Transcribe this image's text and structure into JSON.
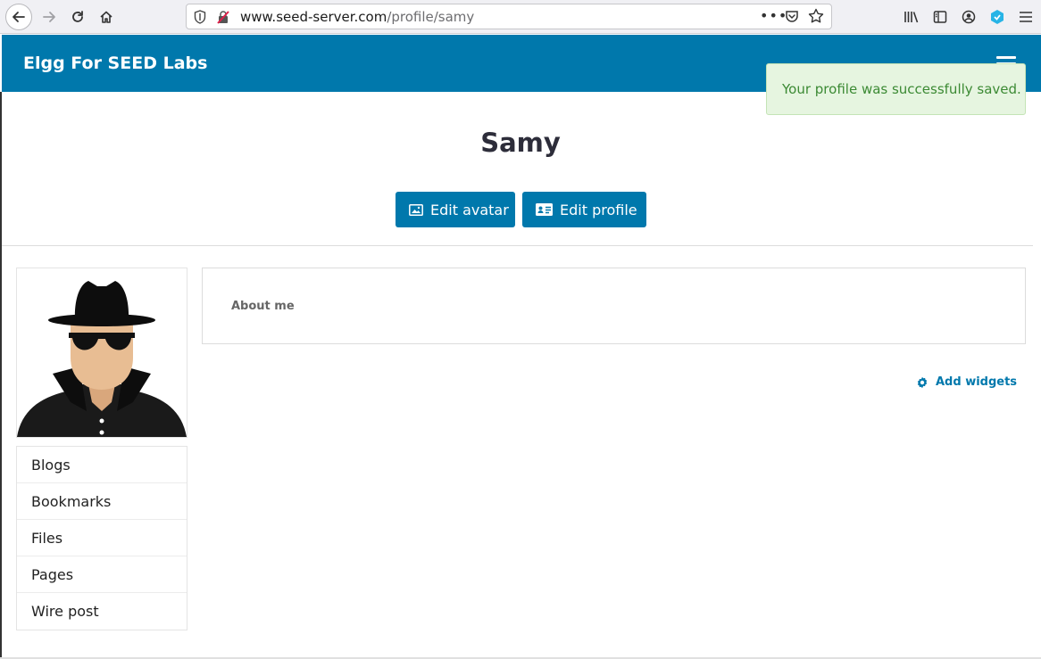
{
  "browser": {
    "url_host": "www.seed-server.com",
    "url_path": "/profile/samy",
    "more_label": "•••"
  },
  "header": {
    "site_title": "Elgg For SEED Labs"
  },
  "notification": {
    "message": "Your profile was successfully saved."
  },
  "profile": {
    "name": "Samy",
    "edit_avatar_label": "Edit avatar",
    "edit_profile_label": "Edit profile"
  },
  "sidebar": {
    "items": [
      {
        "label": "Blogs"
      },
      {
        "label": "Bookmarks"
      },
      {
        "label": "Files"
      },
      {
        "label": "Pages"
      },
      {
        "label": "Wire post"
      }
    ]
  },
  "main": {
    "about_title": "About me",
    "add_widgets_label": "Add widgets"
  },
  "colors": {
    "brand": "#0078ac",
    "success_bg": "#e6f5e0",
    "success_text": "#3c8a34"
  },
  "icons": [
    "back-icon",
    "forward-icon",
    "reload-icon",
    "home-icon",
    "shield-icon",
    "insecure-lock-icon",
    "pocket-icon",
    "star-icon",
    "library-icon",
    "sidebar-icon",
    "account-icon",
    "extension-icon",
    "menu-icon",
    "hamburger-icon",
    "image-icon",
    "id-card-icon",
    "gear-icon"
  ]
}
